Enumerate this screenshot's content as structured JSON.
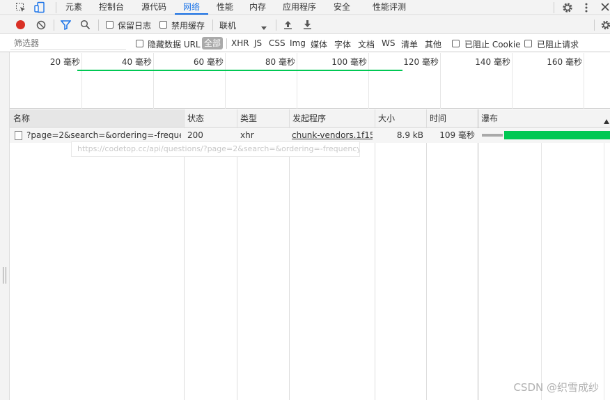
{
  "tabs": {
    "items": [
      "元素",
      "控制台",
      "源代码",
      "网络",
      "性能",
      "内存",
      "应用程序",
      "安全",
      "性能评测"
    ],
    "active": "网络"
  },
  "toolbar": {
    "preserve_log": "保留日志",
    "disable_cache": "禁用缓存",
    "throttle_value": "联机"
  },
  "filter": {
    "placeholder": "筛选器",
    "hide_data_url": "隐藏数据 URL",
    "types": [
      "全部",
      "XHR",
      "JS",
      "CSS",
      "Img",
      "媒体",
      "字体",
      "文档",
      "WS",
      "清单",
      "其他"
    ],
    "blocked_cookies": "已阻止 Cookie",
    "blocked_requests": "已阻止请求"
  },
  "overview": {
    "ticks": [
      "20 毫秒",
      "40 毫秒",
      "60 毫秒",
      "80 毫秒",
      "100 毫秒",
      "120 毫秒",
      "140 毫秒",
      "160 毫秒"
    ]
  },
  "table": {
    "headers": [
      "名称",
      "状态",
      "类型",
      "发起程序",
      "大小",
      "时间",
      "瀑布"
    ],
    "rows": [
      {
        "name": "?page=2&search=&ordering=-frequency",
        "status": "200",
        "type": "xhr",
        "initiator": "chunk-vendors.1f15...",
        "size": "8.9 kB",
        "time": "109 毫秒"
      }
    ],
    "tooltip": "https://codetop.cc/api/questions/?page=2&search=&ordering=-frequency"
  },
  "watermark": "CSDN @织雪成纱",
  "colors": {
    "accent": "#1a73e8",
    "record": "#d93025",
    "waterfall_bar": "#00c853"
  }
}
